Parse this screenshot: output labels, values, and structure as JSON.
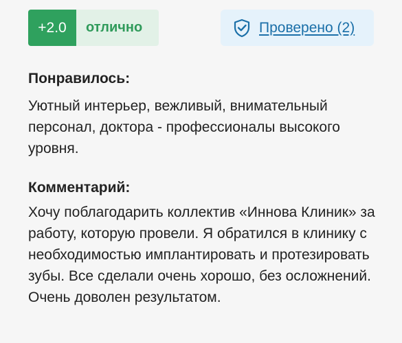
{
  "rating": {
    "score": "+2.0",
    "label": "отлично"
  },
  "verified": {
    "icon": "shield-check-icon",
    "label": "Проверено (2)"
  },
  "liked": {
    "title": "Понравилось:",
    "text": "Уютный интерьер, вежливый, внимательный персонал, доктора - профессионалы высокого уровня."
  },
  "comment": {
    "title": "Комментарий:",
    "text": "Хочу поблагодарить коллектив «Иннова Клиник» за работу, которую провели. Я обратился в клинику с необходимостью имплантировать и протезировать зубы. Все сделали очень хорошо, без осложнений. Очень доволен результатом."
  },
  "colors": {
    "score_bg": "#2fa15e",
    "label_bg": "#e2f1e7",
    "verified_bg": "#e5f2fb",
    "link": "#1a6fa8"
  }
}
